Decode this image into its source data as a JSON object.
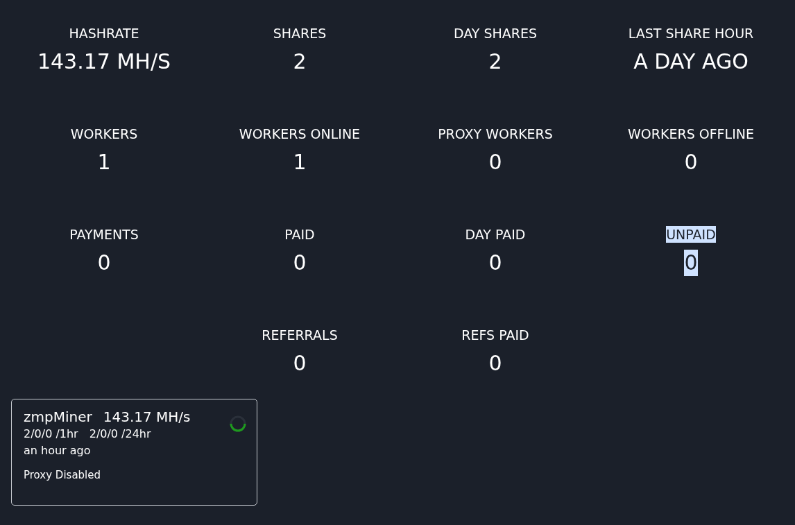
{
  "stat_rows": [
    {
      "stats": [
        {
          "label": "HASHRATE",
          "value": "143.17 MH/S",
          "highlighted": false
        },
        {
          "label": "SHARES",
          "value": "2",
          "highlighted": false
        },
        {
          "label": "DAY SHARES",
          "value": "2",
          "highlighted": false
        },
        {
          "label": "LAST SHARE HOUR",
          "value": "A DAY AGO",
          "highlighted": false
        }
      ]
    },
    {
      "stats": [
        {
          "label": "WORKERS",
          "value": "1",
          "highlighted": false
        },
        {
          "label": "WORKERS ONLINE",
          "value": "1",
          "highlighted": false
        },
        {
          "label": "PROXY WORKERS",
          "value": "0",
          "highlighted": false
        },
        {
          "label": "WORKERS OFFLINE",
          "value": "0",
          "highlighted": false
        }
      ]
    },
    {
      "stats": [
        {
          "label": "PAYMENTS",
          "value": "0",
          "highlighted": false
        },
        {
          "label": "PAID",
          "value": "0",
          "highlighted": false
        },
        {
          "label": "DAY PAID",
          "value": "0",
          "highlighted": false
        },
        {
          "label": "UNPAID",
          "value": "0",
          "highlighted": true
        }
      ]
    },
    {
      "stats": [
        {
          "label": "REFERRALS",
          "value": "0",
          "highlighted": false
        },
        {
          "label": "REFS PAID",
          "value": "0",
          "highlighted": false
        }
      ]
    }
  ],
  "workers": [
    {
      "name": "zmpMiner",
      "hashrate": "143.17 MH/s",
      "shares_1h": "2/0/0 /1hr",
      "shares_24h": "2/0/0 /24hr",
      "last_seen": "an hour ago",
      "proxy": "Proxy Disabled"
    }
  ]
}
